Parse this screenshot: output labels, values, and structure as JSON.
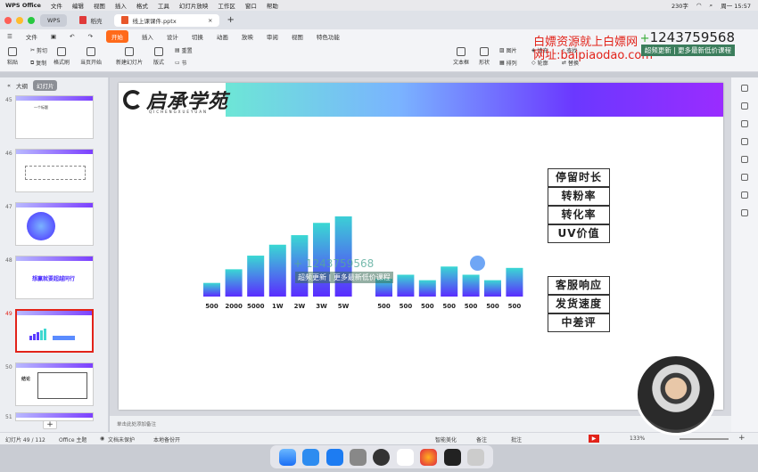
{
  "menubar": {
    "app": "WPS Office",
    "items": [
      "文件",
      "编辑",
      "视图",
      "插入",
      "格式",
      "工具",
      "幻灯片放映",
      "工作区",
      "窗口",
      "帮助"
    ],
    "battery": "230字",
    "clock": "周一 15:57"
  },
  "tabs": [
    {
      "label": "WPS"
    },
    {
      "label": "稻壳"
    },
    {
      "label": "线上课课件.pptx"
    }
  ],
  "ribbon_tabs": {
    "items": [
      "文件",
      "开始",
      "插入",
      "设计",
      "切换",
      "动画",
      "放映",
      "审阅",
      "视图",
      "特色功能"
    ],
    "active": "开始"
  },
  "toolbar": {
    "paste": "粘贴",
    "cut": "剪切",
    "copy": "复制",
    "format": "格式刷",
    "play": "当页开始",
    "newslide": "新建幻灯片",
    "layout": "版式",
    "section": "节",
    "reset": "重置",
    "textbox": "文本框",
    "shape": "形状",
    "picture": "图片",
    "arrange": "排列",
    "fill": "填充",
    "outline": "轮廓",
    "find": "查找",
    "replace": "替换"
  },
  "watermark": {
    "phone": "1243759568",
    "banner": "超频更新 | 更多最新低价课程",
    "red_line1": "白嫖资源就上白嫖网",
    "red_line2": "网址:baipiaodao.com"
  },
  "panel": {
    "outline": "大纲",
    "slides": "幻灯片"
  },
  "thumbnails": [
    {
      "num": "45",
      "title": "一个标题"
    },
    {
      "num": "46",
      "title": ""
    },
    {
      "num": "47",
      "title": ""
    },
    {
      "num": "48",
      "title": "想赢就要超越同行"
    },
    {
      "num": "49",
      "title": ""
    },
    {
      "num": "50",
      "title": "结论"
    },
    {
      "num": "51",
      "title": ""
    }
  ],
  "slide": {
    "logo_text": "启承学苑",
    "logo_sub": "QICHENGXUEYUAN",
    "right_labels_top": [
      "停留时长",
      "转粉率",
      "转化率",
      "UV价值"
    ],
    "right_labels_bottom": [
      "客服响应",
      "发货速度",
      "中差评"
    ],
    "center_wm_phone": "1243759568",
    "center_wm_banner": "超频更新 | 更多最新低价课程"
  },
  "chart_data": [
    {
      "type": "bar",
      "categories": [
        "500",
        "2000",
        "5000",
        "1W",
        "2W",
        "3W",
        "5W"
      ],
      "values": [
        1,
        2,
        3,
        3.8,
        4.5,
        5.4,
        6.2
      ]
    },
    {
      "type": "bar",
      "categories": [
        "500",
        "500",
        "500",
        "500",
        "500",
        "500",
        "500"
      ],
      "values": [
        1.3,
        1.6,
        1.2,
        2.2,
        1.6,
        1.2,
        2.1
      ]
    }
  ],
  "notes": {
    "placeholder": "单击此处添加备注"
  },
  "status": {
    "slide": "幻灯片 49 / 112",
    "theme": "Office 主题",
    "protect": "文档未保护",
    "backup": "本地备份开",
    "beautify": "智能美化",
    "comments": "备注",
    "review": "批注",
    "zoom": "133%"
  }
}
